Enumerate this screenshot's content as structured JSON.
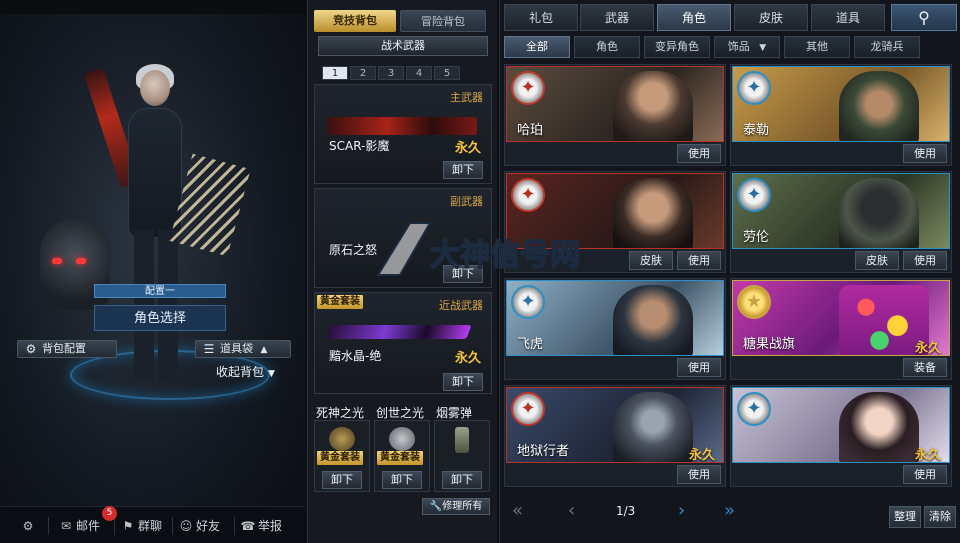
{
  "left_panel": {
    "loadout_tag": "配置一",
    "role_select": "角色选择",
    "bag_config": "背包配置",
    "tool_bag": "道具袋",
    "collapse_pack": "收起背包"
  },
  "bottom_bar": {
    "mail": "邮件",
    "mail_badge": "5",
    "group_chat": "群聊",
    "friends": "好友",
    "report": "举报"
  },
  "backpack": {
    "tabs": [
      "竞技背包",
      "冒险背包"
    ],
    "tactical_weapons": "战术武器",
    "pages": [
      "1",
      "2",
      "3",
      "4",
      "5"
    ],
    "active_page": "1",
    "primary": {
      "type": "主武器",
      "name": "SCAR-影魔",
      "duration": "永久",
      "action": "卸下"
    },
    "secondary": {
      "type": "副武器",
      "name": "原石之怒",
      "action": "卸下"
    },
    "melee": {
      "tag": "黄金套装",
      "type": "近战武器",
      "name": "黯水晶-绝",
      "duration": "永久",
      "action": "卸下"
    },
    "throwables": [
      {
        "name": "死神之光",
        "tag": "黄金套装",
        "action": "卸下"
      },
      {
        "name": "创世之光",
        "tag": "黄金套装",
        "action": "卸下"
      },
      {
        "name": "烟雾弹",
        "action": "卸下"
      }
    ],
    "repair_all": "修理所有"
  },
  "store": {
    "main_tabs": [
      "礼包",
      "武器",
      "角色",
      "皮肤",
      "道具"
    ],
    "active_main_tab": "角色",
    "sub_tabs": [
      "全部",
      "角色",
      "变异角色",
      "饰品",
      "其他",
      "龙骑兵"
    ],
    "active_sub_tab": "全部",
    "cards": [
      {
        "name": "哈珀",
        "buttons": [
          "使用"
        ],
        "theme": "red"
      },
      {
        "name": "泰勒",
        "buttons": [
          "使用"
        ],
        "theme": "blue"
      },
      {
        "name": "",
        "buttons": [
          "皮肤",
          "使用"
        ],
        "theme": "red"
      },
      {
        "name": "劳伦",
        "buttons": [
          "皮肤",
          "使用"
        ],
        "theme": "blue"
      },
      {
        "name": "飞虎",
        "buttons": [
          "使用"
        ],
        "theme": "blue"
      },
      {
        "name": "糖果战旗",
        "duration": "永久",
        "buttons": [
          "装备"
        ],
        "theme": "gold"
      },
      {
        "name": "地狱行者",
        "duration": "永久",
        "buttons": [
          "使用"
        ],
        "theme": "red"
      },
      {
        "name": "",
        "duration": "永久",
        "buttons": [
          "使用"
        ],
        "theme": "blue"
      }
    ],
    "page": "1/3",
    "arrange": "整理",
    "clear": "清除"
  },
  "watermark_text": "大神信号网",
  "colors": {
    "accent_gold": "#f3c23e",
    "accent_blue": "#2e8fc7",
    "accent_red": "#b8322a"
  }
}
